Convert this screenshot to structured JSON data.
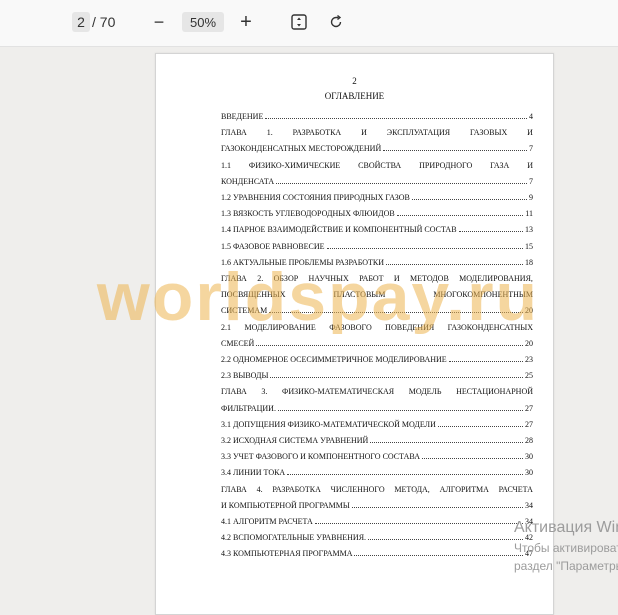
{
  "toolbar": {
    "page_current": "2",
    "page_total": "/ 70",
    "zoom_out_icon": "−",
    "zoom_level": "50%",
    "zoom_in_icon": "+"
  },
  "document": {
    "page_number": "2",
    "heading": "ОГЛАВЛЕНИЕ",
    "toc": [
      {
        "text": "ВВЕДЕНИЕ",
        "page": "4"
      },
      {
        "text": "ГЛАВА 1. РАЗРАБОТКА И ЭКСПЛУАТАЦИЯ ГАЗОВЫХ И",
        "page": ""
      },
      {
        "text": "ГАЗОКОНДЕНСАТНЫХ МЕСТОРОЖДЕНИЙ",
        "page": "7"
      },
      {
        "text": "1.1 ФИЗИКО-ХИМИЧЕСКИЕ СВОЙСТВА ПРИРОДНОГО ГАЗА И",
        "page": ""
      },
      {
        "text": "КОНДЕНСАТА",
        "page": "7"
      },
      {
        "text": "1.2 УРАВНЕНИЯ СОСТОЯНИЯ ПРИРОДНЫХ ГАЗОВ",
        "page": "9"
      },
      {
        "text": "1.3 ВЯЗКОСТЬ УГЛЕВОДОРОДНЫХ ФЛЮИДОВ",
        "page": "11"
      },
      {
        "text": "1.4 ПАРНОЕ ВЗАИМОДЕЙСТВИЕ И КОМПОНЕНТНЫЙ СОСТАВ",
        "page": "13"
      },
      {
        "text": "1.5 ФАЗОВОЕ РАВНОВЕСИЕ",
        "page": "15"
      },
      {
        "text": "1.6 АКТУАЛЬНЫЕ ПРОБЛЕМЫ РАЗРАБОТКИ",
        "page": "18"
      },
      {
        "text": "ГЛАВА 2. ОБЗОР НАУЧНЫХ РАБОТ И МЕТОДОВ МОДЕЛИРОВАНИЯ,",
        "page": ""
      },
      {
        "text": "ПОСВЯЩЕННЫХ ПЛАСТОВЫМ МНОГОКОМПОНЕНТНЫМ",
        "page": ""
      },
      {
        "text": "СИСТЕМАМ",
        "page": "20"
      },
      {
        "text": "2.1 МОДЕЛИРОВАНИЕ ФАЗОВОГО ПОВЕДЕНИЯ ГАЗОКОНДЕНСАТНЫХ",
        "page": ""
      },
      {
        "text": "СМЕСЕЙ",
        "page": "20"
      },
      {
        "text": "2.2 ОДНОМЕРНОЕ ОСЕСИММЕТРИЧНОЕ МОДЕЛИРОВАНИЕ",
        "page": "23"
      },
      {
        "text": "2.3 ВЫВОДЫ",
        "page": "25"
      },
      {
        "text": "ГЛАВА 3. ФИЗИКО-МАТЕМАТИЧЕСКАЯ МОДЕЛЬ НЕСТАЦИОНАРНОЙ",
        "page": ""
      },
      {
        "text": "ФИЛЬТРАЦИИ.",
        "page": "27"
      },
      {
        "text": "3.1 ДОПУЩЕНИЯ ФИЗИКО-МАТЕМАТИЧЕСКОЙ МОДЕЛИ",
        "page": "27"
      },
      {
        "text": "3.2 ИСХОДНАЯ СИСТЕМА УРАВНЕНИЙ",
        "page": "28"
      },
      {
        "text": "3.3 УЧЕТ ФАЗОВОГО И КОМПОНЕНТНОГО СОСТАВА",
        "page": "30"
      },
      {
        "text": "3.4 ЛИНИИ ТОКА",
        "page": "30"
      },
      {
        "text": "ГЛАВА 4. РАЗРАБОТКА ЧИСЛЕННОГО МЕТОДА, АЛГОРИТМА РАСЧЕТА",
        "page": ""
      },
      {
        "text": "И КОМПЬЮТЕРНОЙ ПРОГРАММЫ",
        "page": "34"
      },
      {
        "text": "4.1 АЛГОРИТМ РАСЧЕТА",
        "page": "34"
      },
      {
        "text": "4.2 ВСПОМОГАТЕЛЬНЫЕ УРАВНЕНИЯ.",
        "page": "42"
      },
      {
        "text": "4.3 КОМПЬЮТЕРНАЯ ПРОГРАММА",
        "page": "47"
      }
    ]
  },
  "watermark": "worldspay.ru",
  "activation": {
    "title": "Активация Windows",
    "subtitle1": "Чтобы активировать Windows, перейдите в",
    "subtitle2": "раздел \"Параметры\"."
  },
  "colors": {
    "toolbar_bg": "#f9f9f9",
    "workspace_bg": "#efeeec",
    "watermark": "#ecb450"
  }
}
